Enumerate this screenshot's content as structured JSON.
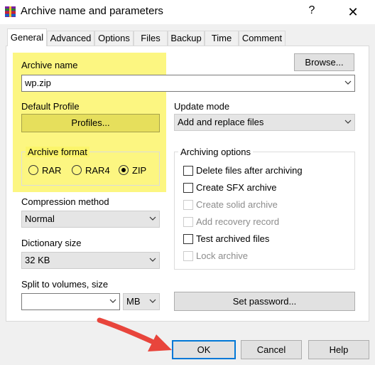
{
  "window": {
    "title": "Archive name and parameters",
    "help_label": "?",
    "close_label": "✕"
  },
  "tabs": [
    {
      "label": "General"
    },
    {
      "label": "Advanced"
    },
    {
      "label": "Options"
    },
    {
      "label": "Files"
    },
    {
      "label": "Backup"
    },
    {
      "label": "Time"
    },
    {
      "label": "Comment"
    }
  ],
  "general": {
    "archive_name_label": "Archive name",
    "archive_name_value": "wp.zip",
    "browse_button": "Browse...",
    "default_profile_label": "Default Profile",
    "profiles_button": "Profiles...",
    "update_mode_label": "Update mode",
    "update_mode_value": "Add and replace files",
    "archive_format": {
      "title": "Archive format",
      "options": [
        "RAR",
        "RAR4",
        "ZIP"
      ],
      "selected": "ZIP"
    },
    "archiving_options": {
      "title": "Archiving options",
      "items": [
        {
          "label": "Delete files after archiving",
          "checked": false,
          "enabled": true
        },
        {
          "label": "Create SFX archive",
          "checked": false,
          "enabled": true
        },
        {
          "label": "Create solid archive",
          "checked": false,
          "enabled": false
        },
        {
          "label": "Add recovery record",
          "checked": false,
          "enabled": false
        },
        {
          "label": "Test archived files",
          "checked": false,
          "enabled": true
        },
        {
          "label": "Lock archive",
          "checked": false,
          "enabled": false
        }
      ]
    },
    "compression_method_label": "Compression method",
    "compression_method_value": "Normal",
    "dictionary_size_label": "Dictionary size",
    "dictionary_size_value": "32 KB",
    "split_label": "Split to volumes, size",
    "split_value": "",
    "split_unit": "MB",
    "set_password_button": "Set password..."
  },
  "footer": {
    "ok": "OK",
    "cancel": "Cancel",
    "help": "Help"
  },
  "colors": {
    "highlight": "#fbf56b",
    "annotation_arrow": "#e8453c",
    "ok_focus_border": "#0078d7"
  }
}
